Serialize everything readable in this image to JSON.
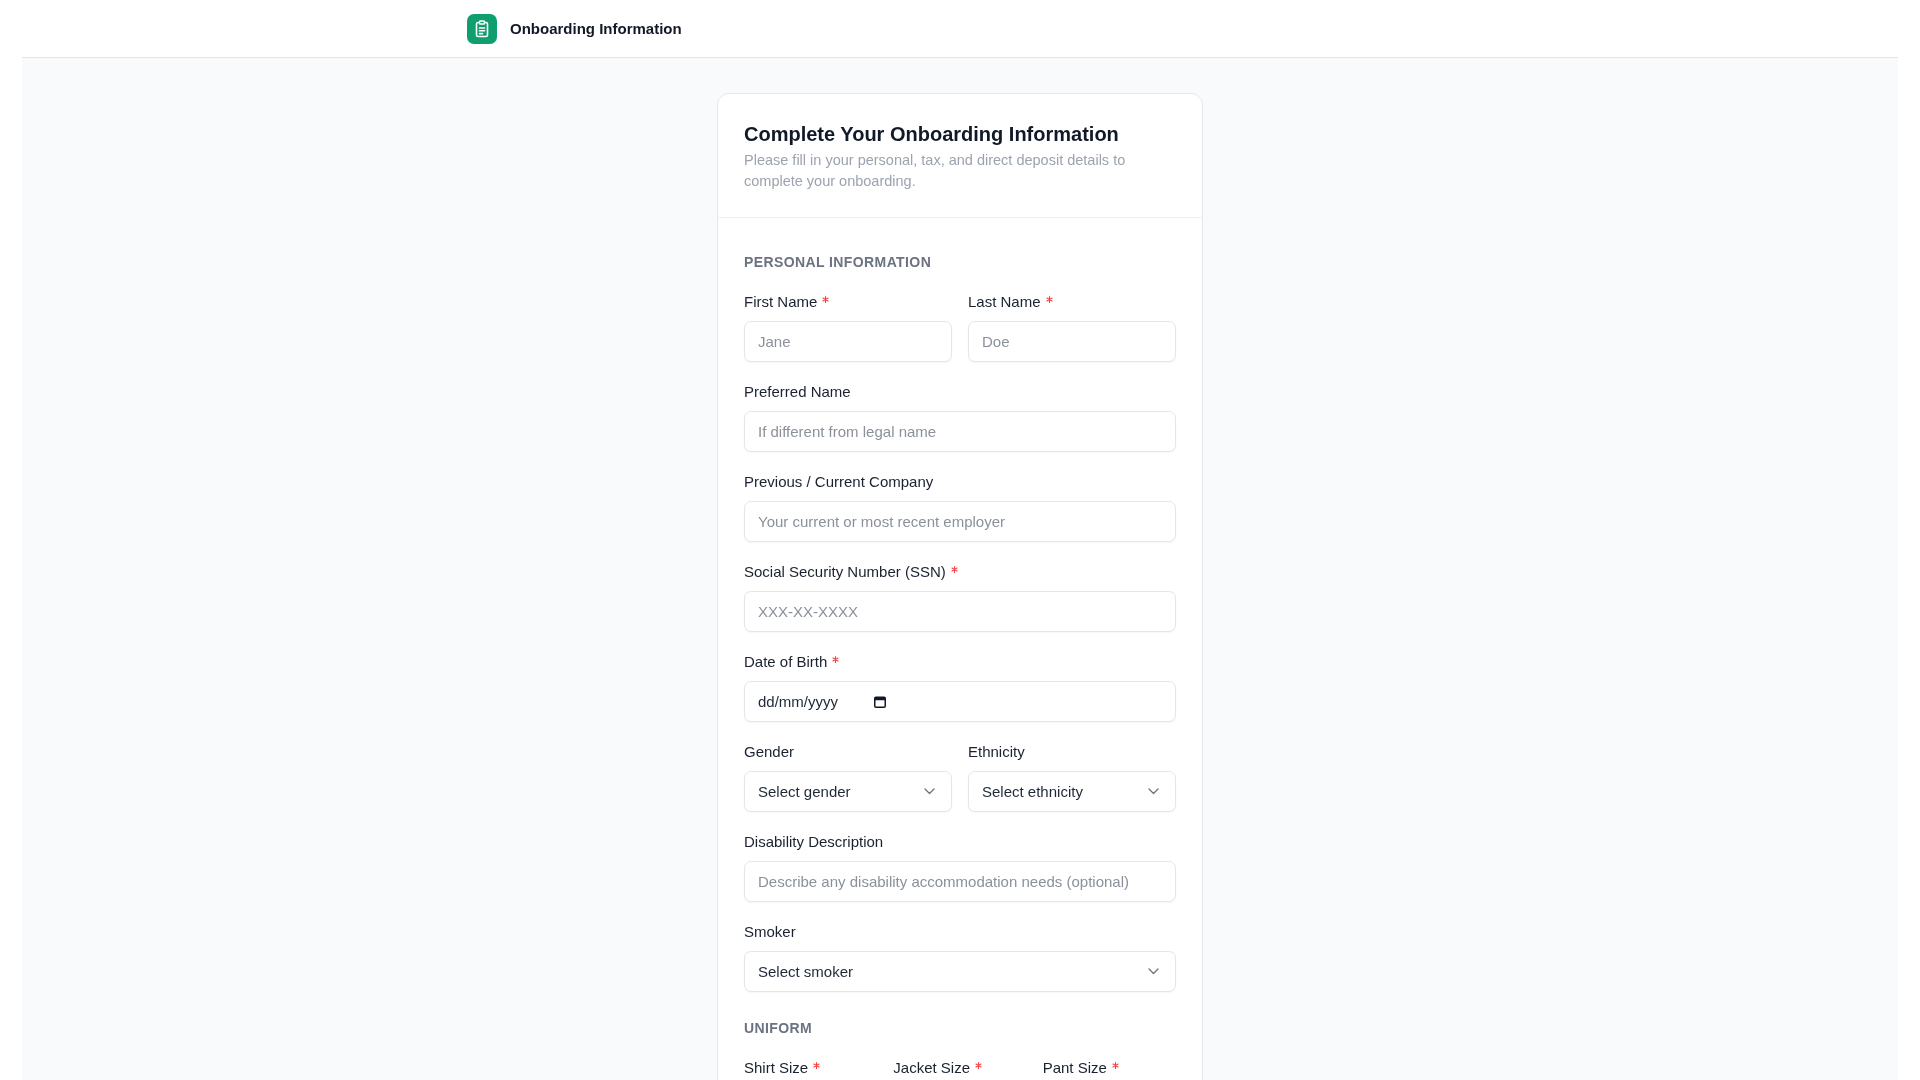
{
  "header": {
    "title": "Onboarding Information"
  },
  "card": {
    "title": "Complete Your Onboarding Information",
    "description": "Please fill in your personal, tax, and direct deposit details to complete your onboarding."
  },
  "sections": [
    {
      "title": "PERSONAL INFORMATION",
      "rows": [
        {
          "fields": [
            {
              "label": "First Name",
              "required": true,
              "kind": "text",
              "placeholder": "Jane"
            },
            {
              "label": "Last Name",
              "required": true,
              "kind": "text",
              "placeholder": "Doe"
            }
          ]
        },
        {
          "fields": [
            {
              "label": "Preferred Name",
              "required": false,
              "kind": "text",
              "placeholder": "If different from legal name"
            }
          ]
        },
        {
          "fields": [
            {
              "label": "Previous / Current Company",
              "required": false,
              "kind": "text",
              "placeholder": "Your current or most recent employer"
            }
          ]
        },
        {
          "fields": [
            {
              "label": "Social Security Number (SSN)",
              "required": true,
              "kind": "text",
              "placeholder": "XXX-XX-XXXX"
            }
          ]
        },
        {
          "fields": [
            {
              "label": "Date of Birth",
              "required": true,
              "kind": "date",
              "placeholder": "dd/mm/yyyy"
            }
          ]
        },
        {
          "fields": [
            {
              "label": "Gender",
              "required": false,
              "kind": "select",
              "value": "Select gender"
            },
            {
              "label": "Ethnicity",
              "required": false,
              "kind": "select",
              "value": "Select ethnicity"
            }
          ]
        },
        {
          "fields": [
            {
              "label": "Disability Description",
              "required": false,
              "kind": "text",
              "placeholder": "Describe any disability accommodation needs (optional)"
            }
          ]
        },
        {
          "fields": [
            {
              "label": "Smoker",
              "required": false,
              "kind": "select",
              "value": "Select smoker"
            }
          ]
        }
      ]
    },
    {
      "title": "UNIFORM",
      "rows": [
        {
          "fields": [
            {
              "label": "Shirt Size",
              "required": true
            },
            {
              "label": "Jacket Size",
              "required": true
            },
            {
              "label": "Pant Size",
              "required": true
            }
          ]
        }
      ]
    }
  ]
}
